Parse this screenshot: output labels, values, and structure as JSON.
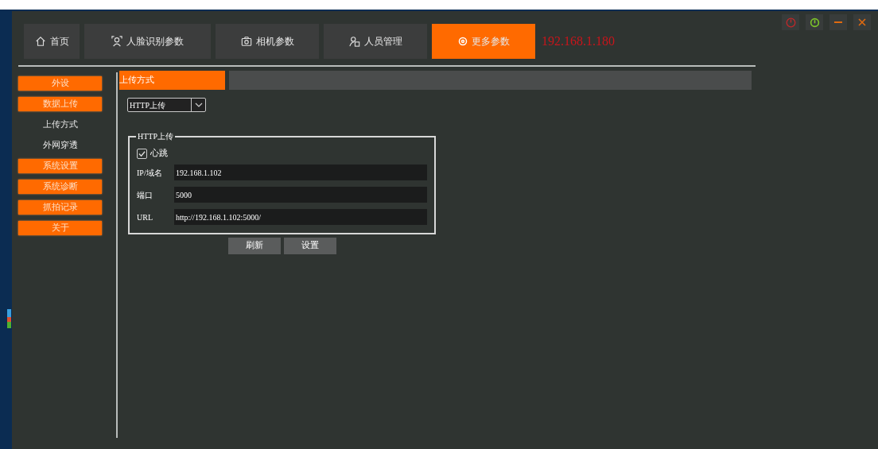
{
  "tabs": [
    {
      "label": "首页",
      "kind": "home",
      "selected": false
    },
    {
      "label": "人脸识别参数",
      "kind": "face",
      "selected": false
    },
    {
      "label": "相机参数",
      "kind": "camera",
      "selected": false
    },
    {
      "label": "人员管理",
      "kind": "person",
      "selected": false
    },
    {
      "label": "更多参数",
      "kind": "gear",
      "selected": true
    }
  ],
  "device_ip": "192.168.1.180",
  "sidebar": {
    "items": [
      {
        "label": "外设",
        "kind": "section"
      },
      {
        "label": "数据上传",
        "kind": "section"
      },
      {
        "label": "上传方式",
        "kind": "sub"
      },
      {
        "label": "外网穿透",
        "kind": "sub"
      },
      {
        "label": "系统设置",
        "kind": "section"
      },
      {
        "label": "系统诊断",
        "kind": "section"
      },
      {
        "label": "抓拍记录",
        "kind": "section"
      },
      {
        "label": "关于",
        "kind": "section"
      }
    ]
  },
  "panel_title": "上传方式",
  "upload_mode": {
    "value": "HTTP上传"
  },
  "group": {
    "title": "HTTP上传",
    "heartbeat": {
      "label": "心跳",
      "checked": true
    },
    "fields": [
      {
        "label": "IP/域名",
        "value": "192.168.1.102"
      },
      {
        "label": "端口",
        "value": "5000"
      },
      {
        "label": "URL",
        "value": "http://192.168.1.102:5000/"
      }
    ]
  },
  "buttons": [
    "刷新",
    "设置"
  ]
}
